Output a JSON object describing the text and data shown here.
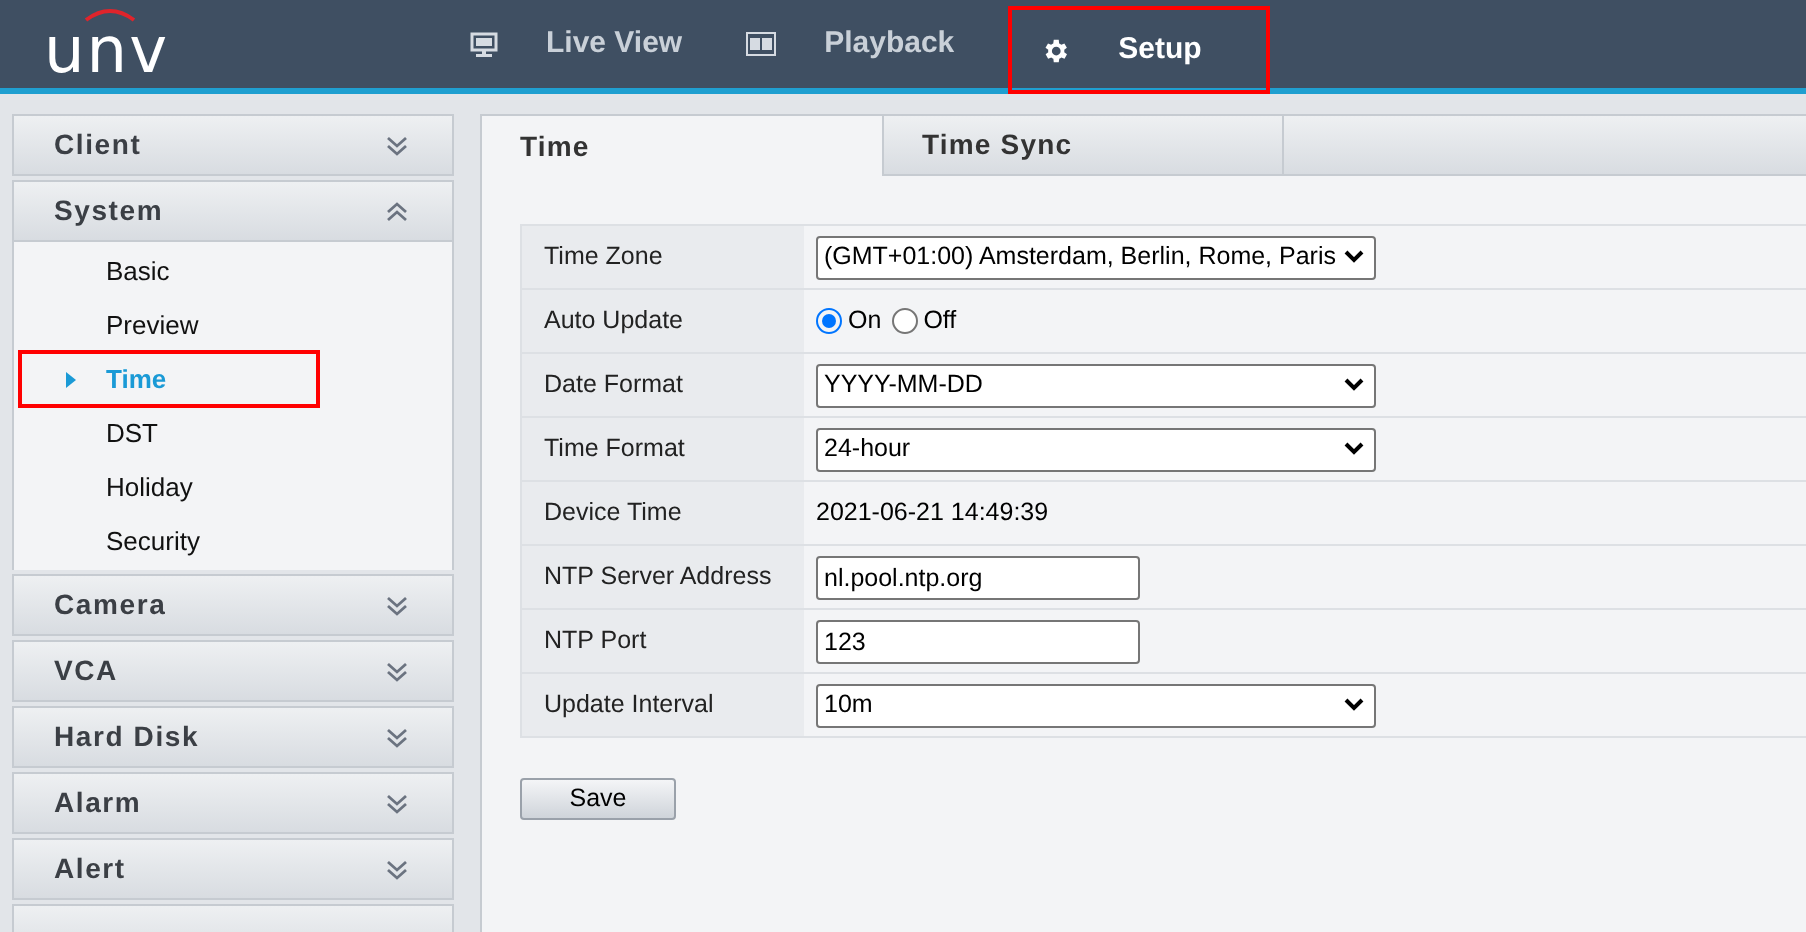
{
  "header": {
    "logo": "unv",
    "nav": [
      {
        "label": "Live View",
        "selected": false,
        "highlighted": false
      },
      {
        "label": "Playback",
        "selected": false,
        "highlighted": false
      },
      {
        "label": "Setup",
        "selected": true,
        "highlighted": true
      }
    ]
  },
  "sidebar": {
    "sections": [
      {
        "label": "Client",
        "expanded": false
      },
      {
        "label": "System",
        "expanded": true,
        "children": [
          {
            "label": "Basic",
            "selected": false,
            "highlighted": false
          },
          {
            "label": "Preview",
            "selected": false,
            "highlighted": false
          },
          {
            "label": "Time",
            "selected": true,
            "highlighted": true
          },
          {
            "label": "DST",
            "selected": false,
            "highlighted": false
          },
          {
            "label": "Holiday",
            "selected": false,
            "highlighted": false
          },
          {
            "label": "Security",
            "selected": false,
            "highlighted": false
          }
        ]
      },
      {
        "label": "Camera",
        "expanded": false
      },
      {
        "label": "VCA",
        "expanded": false
      },
      {
        "label": "Hard Disk",
        "expanded": false
      },
      {
        "label": "Alarm",
        "expanded": false
      },
      {
        "label": "Alert",
        "expanded": false
      }
    ]
  },
  "tabs": [
    {
      "label": "Time",
      "selected": true
    },
    {
      "label": "Time Sync",
      "selected": false
    }
  ],
  "form": [
    {
      "kind": "select",
      "label": "Time Zone",
      "value": "(GMT+01:00) Amsterdam, Berlin, Rome, Paris"
    },
    {
      "kind": "radio",
      "label": "Auto Update",
      "options": [
        {
          "label": "On",
          "selected": true
        },
        {
          "label": "Off",
          "selected": false
        }
      ]
    },
    {
      "kind": "select",
      "label": "Date Format",
      "value": "YYYY-MM-DD"
    },
    {
      "kind": "select",
      "label": "Time Format",
      "value": "24-hour"
    },
    {
      "kind": "text",
      "label": "Device Time",
      "value": "2021-06-21 14:49:39"
    },
    {
      "kind": "input",
      "label": "NTP Server Address",
      "value": "nl.pool.ntp.org"
    },
    {
      "kind": "input",
      "label": "NTP Port",
      "value": "123"
    },
    {
      "kind": "select",
      "label": "Update Interval",
      "value": "10m"
    }
  ],
  "save_button": "Save"
}
